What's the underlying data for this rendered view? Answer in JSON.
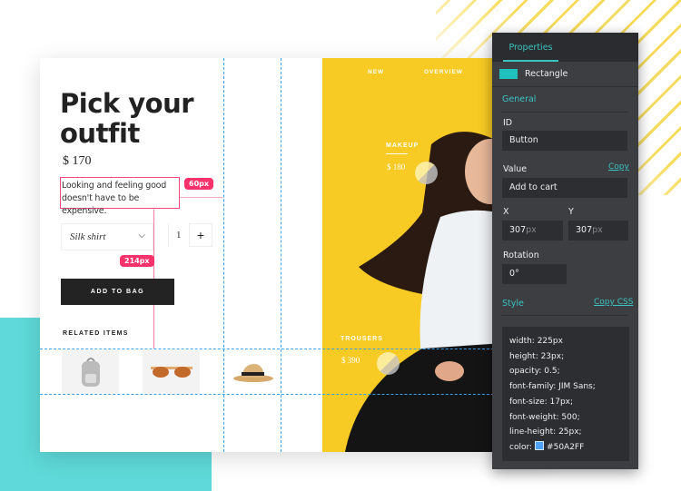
{
  "product": {
    "title_line1": "Pick your",
    "title_line2": "outfit",
    "price": "$ 170",
    "description": "Looking and feeling good doesn't have to be expensive.",
    "size_select": "Silk shirt",
    "quantity": "1",
    "plus": "+",
    "add_button": "ADD TO BAG",
    "related_title": "RELATED ITEMS",
    "related_items": [
      "backpack",
      "sunglasses",
      "hat"
    ]
  },
  "measure": {
    "horizontal": "60px",
    "vertical": "214px"
  },
  "hero": {
    "nav": [
      "NEW",
      "OVERVIEW"
    ],
    "tags": [
      {
        "label": "MAKEUP",
        "price": "$ 180"
      },
      {
        "label": "TROUSERS",
        "price": "$ 390"
      }
    ]
  },
  "panel": {
    "tab": "Properties",
    "element_type": "Rectangle",
    "general": "General",
    "id_label": "ID",
    "id_value": "Button",
    "value_label": "Value",
    "copy": "Copy",
    "value_value": "Add to cart",
    "x_label": "X",
    "x_value": "307",
    "y_label": "Y",
    "y_value": "307",
    "unit": "px",
    "rotation_label": "Rotation",
    "rotation_value": "0°",
    "style": "Style",
    "copy_css": "Copy CSS",
    "css": [
      "width: 225px",
      "height: 23px;",
      "opacity: 0.5;",
      "font-family: JIM Sans;",
      "font-size: 17px;",
      "font-weight: 500;",
      "line-height: 25px;"
    ],
    "color_label": "color:",
    "color_value": "#50A2FF"
  },
  "colors": {
    "accent": "#39c4c0",
    "pink": "#f8326b",
    "yellow": "#f8ca24",
    "guide": "#3aa0f0",
    "teal_bg": "#5fd9d9"
  }
}
